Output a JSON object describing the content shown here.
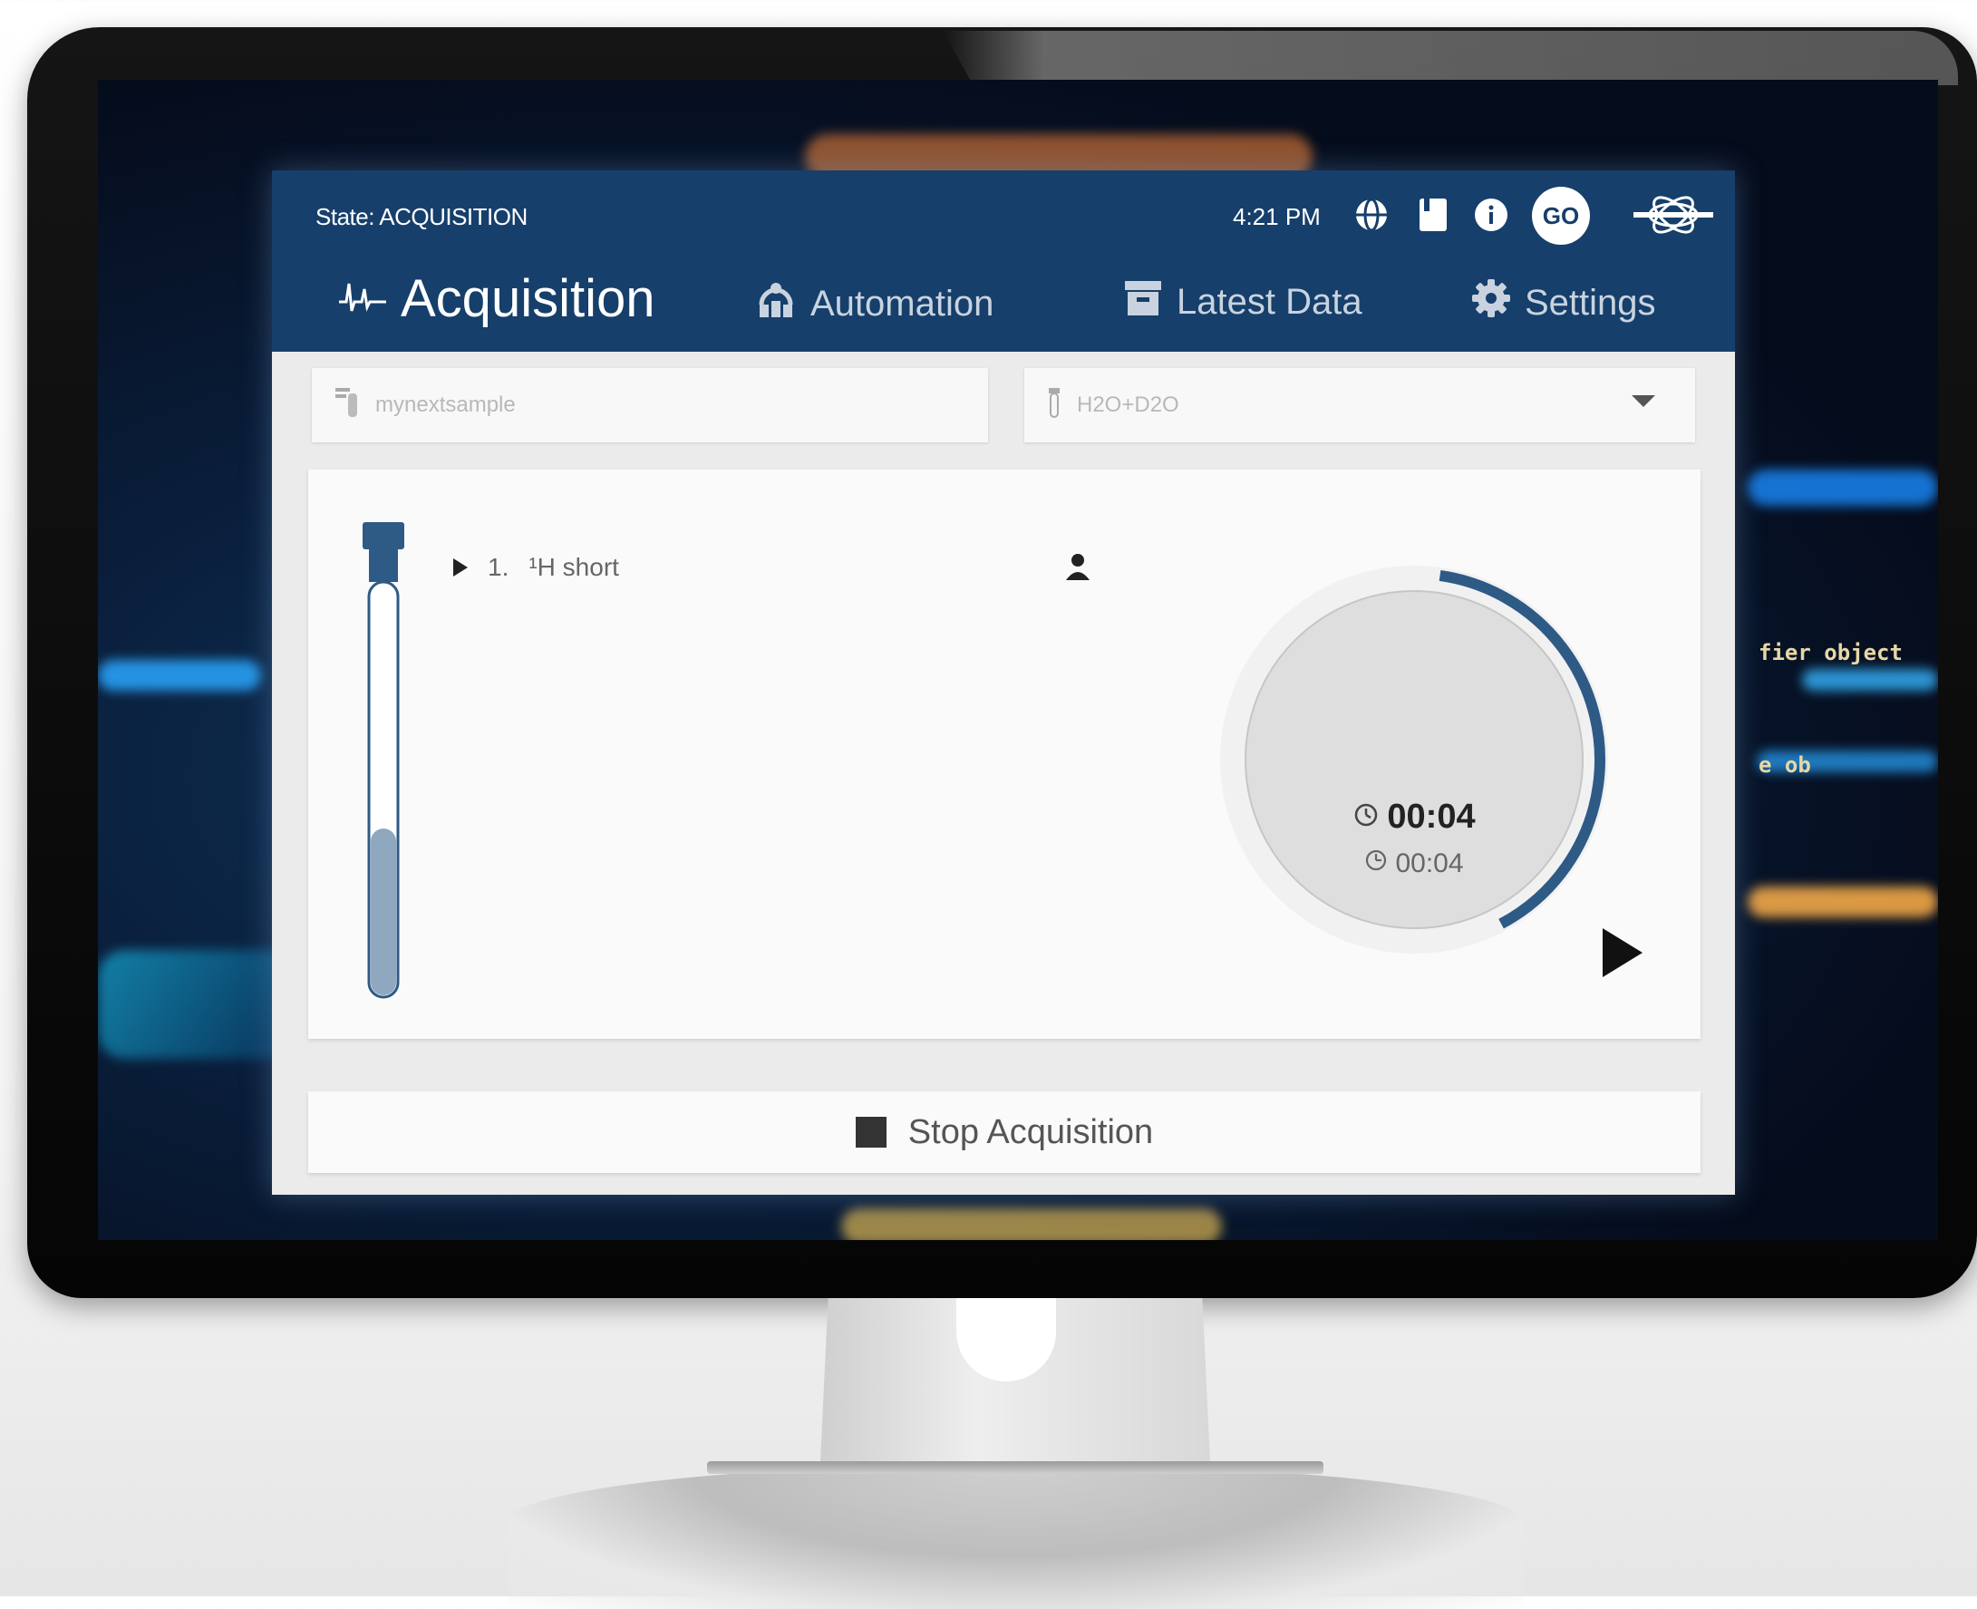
{
  "status": {
    "state_label": "State: ACQUISITION",
    "time": "4:21 PM"
  },
  "header_icons": [
    "globe-icon",
    "book-icon",
    "info-icon",
    "user-avatar",
    "brand-logo"
  ],
  "user": {
    "initials": "GO"
  },
  "nav": {
    "tabs": [
      {
        "label": "Acquisition",
        "icon": "spectrum-icon",
        "active": true
      },
      {
        "label": "Automation",
        "icon": "robot-icon",
        "active": false
      },
      {
        "label": "Latest Data",
        "icon": "archive-icon",
        "active": false
      },
      {
        "label": "Settings",
        "icon": "gear-icon",
        "active": false
      }
    ]
  },
  "sample": {
    "name_value": "mynextsample",
    "solvent_value": "H2O+D2O"
  },
  "experiments": [
    {
      "index": "1.",
      "name": "¹H short"
    }
  ],
  "timer": {
    "elapsed": "00:04",
    "total": "00:04",
    "progress": 0.4
  },
  "actions": {
    "stop_label": "Stop Acquisition"
  },
  "background_code": [
    "fier object",
    "e ob"
  ],
  "colors": {
    "header_bg": "#163f6b",
    "accent": "#2e5a86",
    "panel_bg": "#fafafa"
  }
}
